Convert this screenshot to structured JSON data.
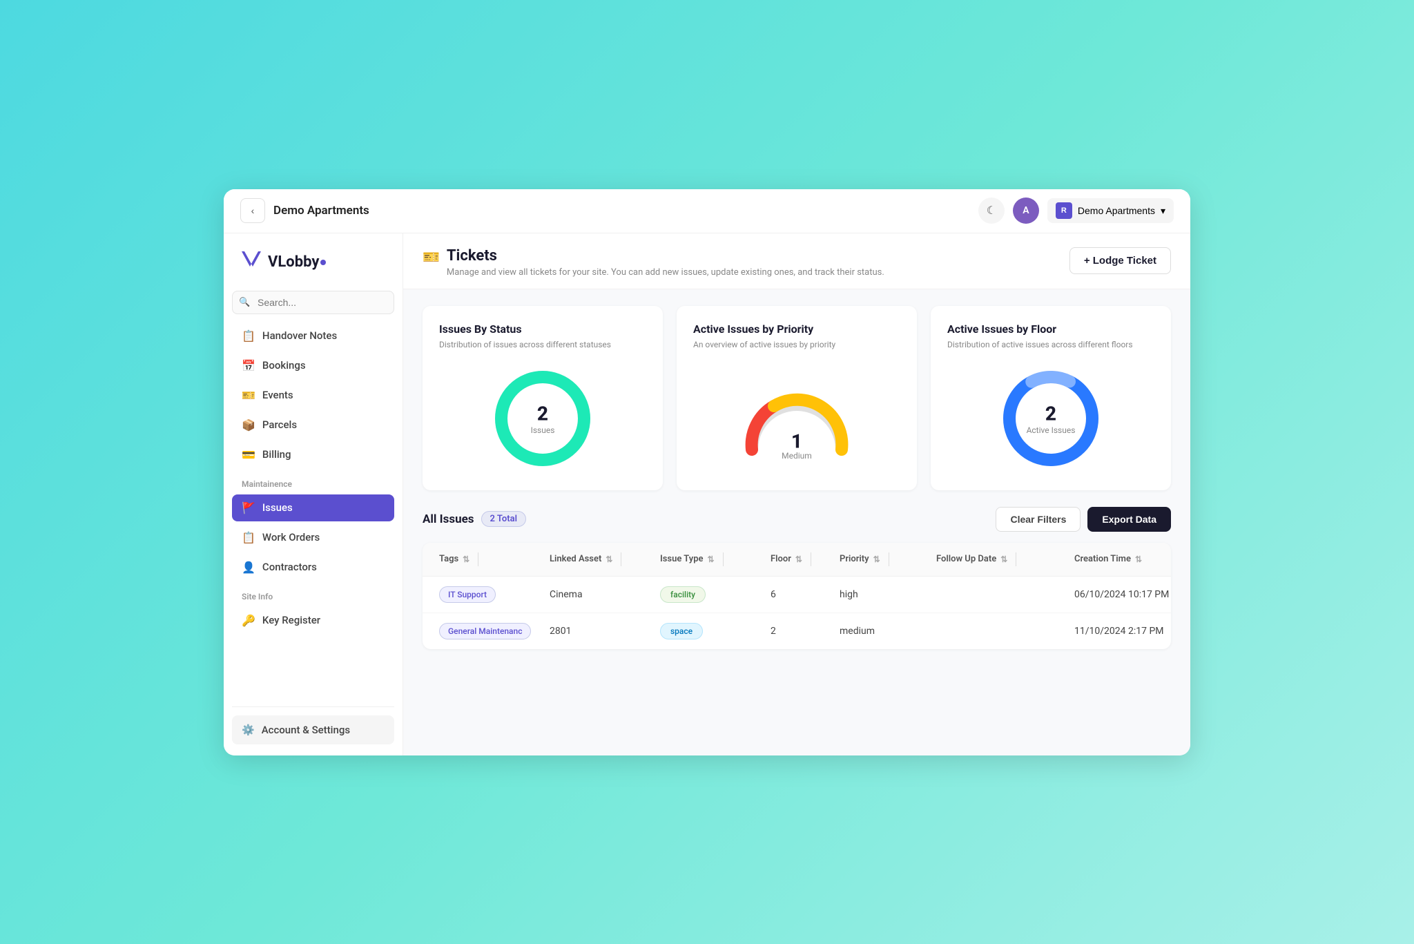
{
  "header": {
    "page_title": "Demo Apartments",
    "collapse_btn_icon": "‹",
    "theme_icon": "☾",
    "site_selector": {
      "label": "Demo Apartments",
      "icon": "R",
      "chevron": "▾"
    }
  },
  "sidebar": {
    "logo": {
      "icon": "V",
      "text": "VLobby"
    },
    "search_placeholder": "Search...",
    "nav_items": [
      {
        "id": "handover-notes",
        "icon": "📋",
        "label": "Handover Notes",
        "active": false
      },
      {
        "id": "bookings",
        "icon": "📅",
        "label": "Bookings",
        "active": false
      },
      {
        "id": "events",
        "icon": "🎫",
        "label": "Events",
        "active": false
      },
      {
        "id": "parcels",
        "icon": "📦",
        "label": "Parcels",
        "active": false
      },
      {
        "id": "billing",
        "icon": "💳",
        "label": "Billing",
        "active": false
      }
    ],
    "maintenance_section_label": "Maintainence",
    "maintenance_items": [
      {
        "id": "issues",
        "icon": "🚩",
        "label": "Issues",
        "active": true
      },
      {
        "id": "work-orders",
        "icon": "📋",
        "label": "Work Orders",
        "active": false
      },
      {
        "id": "contractors",
        "icon": "👤",
        "label": "Contractors",
        "active": false
      }
    ],
    "site_info_label": "Site Info",
    "site_info_items": [
      {
        "id": "key-register",
        "icon": "🔑",
        "label": "Key Register",
        "active": false
      }
    ],
    "footer": {
      "icon": "⚙️",
      "label": "Account & Settings"
    }
  },
  "tickets": {
    "section_icon": "🎫",
    "title": "Tickets",
    "subtitle": "Manage and view all tickets for your site. You can add new issues, update existing ones, and track their status.",
    "lodge_btn": "+ Lodge Ticket"
  },
  "stats": {
    "status_card": {
      "title": "Issues By Status",
      "subtitle": "Distribution of issues across different statuses",
      "value": 2,
      "label": "Issues",
      "color": "#1de9b6"
    },
    "priority_card": {
      "title": "Active Issues by Priority",
      "subtitle": "An overview of active issues by priority",
      "value": 1,
      "label": "Medium"
    },
    "floor_card": {
      "title": "Active Issues by Floor",
      "subtitle": "Distribution of active issues across different floors",
      "value": 2,
      "label": "Active Issues",
      "color": "#2979ff"
    }
  },
  "issues_table": {
    "title": "All Issues",
    "total_label": "2 Total",
    "clear_filters_btn": "Clear Filters",
    "export_btn": "Export Data",
    "columns": [
      {
        "id": "tags",
        "label": "Tags"
      },
      {
        "id": "linked-asset",
        "label": "Linked Asset"
      },
      {
        "id": "issue-type",
        "label": "Issue Type"
      },
      {
        "id": "floor",
        "label": "Floor"
      },
      {
        "id": "priority",
        "label": "Priority"
      },
      {
        "id": "follow-up-date",
        "label": "Follow Up Date"
      },
      {
        "id": "creation-time",
        "label": "Creation Time"
      }
    ],
    "rows": [
      {
        "tag": "IT Support",
        "linked_asset": "Cinema",
        "issue_type": "facility",
        "issue_type_variant": "facility",
        "floor": "6",
        "priority": "high",
        "follow_up_date": "",
        "creation_time": "06/10/2024 10:17 PM"
      },
      {
        "tag": "General Maintenanc",
        "linked_asset": "2801",
        "issue_type": "space",
        "issue_type_variant": "space",
        "floor": "2",
        "priority": "medium",
        "follow_up_date": "",
        "creation_time": "11/10/2024 2:17 PM"
      }
    ]
  }
}
